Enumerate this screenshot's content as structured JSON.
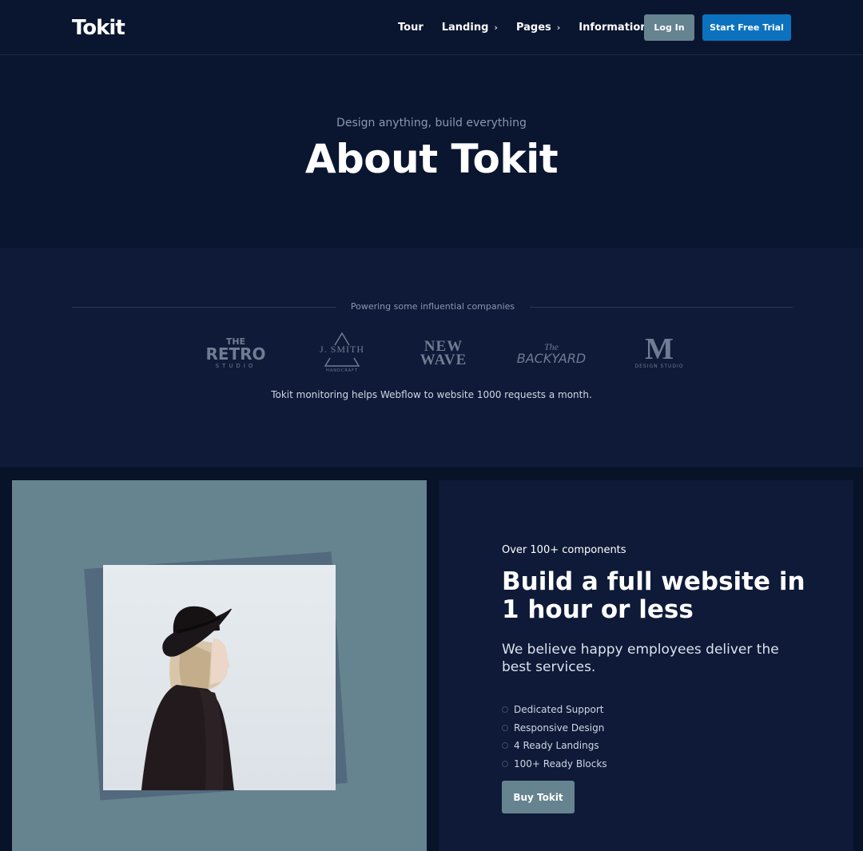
{
  "nav": {
    "logo": "Tokit",
    "links": [
      {
        "label": "Tour",
        "has_dropdown": false
      },
      {
        "label": "Landing",
        "has_dropdown": true
      },
      {
        "label": "Pages",
        "has_dropdown": true
      },
      {
        "label": "Information",
        "has_dropdown": true
      }
    ],
    "login_label": "Log In",
    "trial_label": "Start Free Trial",
    "chevron": "›"
  },
  "hero": {
    "subtitle": "Design anything, build everything",
    "title": "About Tokit"
  },
  "clients": {
    "heading": "Powering some influential companies",
    "logos": [
      {
        "name": "retro-studio-logo",
        "lines": [
          "THE",
          "RETRO",
          "STUDIO"
        ]
      },
      {
        "name": "j-smith-logo",
        "lines": [
          "J. SMITH",
          "HANDCRAFT"
        ]
      },
      {
        "name": "new-wave-logo",
        "lines": [
          "NEW",
          "WAVE"
        ]
      },
      {
        "name": "the-backyard-logo",
        "lines": [
          "The",
          "BACKYARD"
        ]
      },
      {
        "name": "m-design-studio-logo",
        "lines": [
          "M",
          "DESIGN STUDIO"
        ]
      }
    ],
    "caption": "Tokit monitoring helps Webflow to website 1000 requests a month."
  },
  "feature": {
    "eyebrow": "Over 100+ components",
    "title": "Build a full website in 1 hour or less",
    "description": "We believe happy employees deliver the best services.",
    "list": [
      "Dedicated Support",
      "Responsive Design",
      "4 Ready Landings",
      "100+ Ready Blocks"
    ],
    "button_label": "Buy Tokit"
  },
  "colors": {
    "background": "#0a1530",
    "section_alt": "#0e1a38",
    "accent_blue": "#0c72bf",
    "slate": "#668390"
  }
}
